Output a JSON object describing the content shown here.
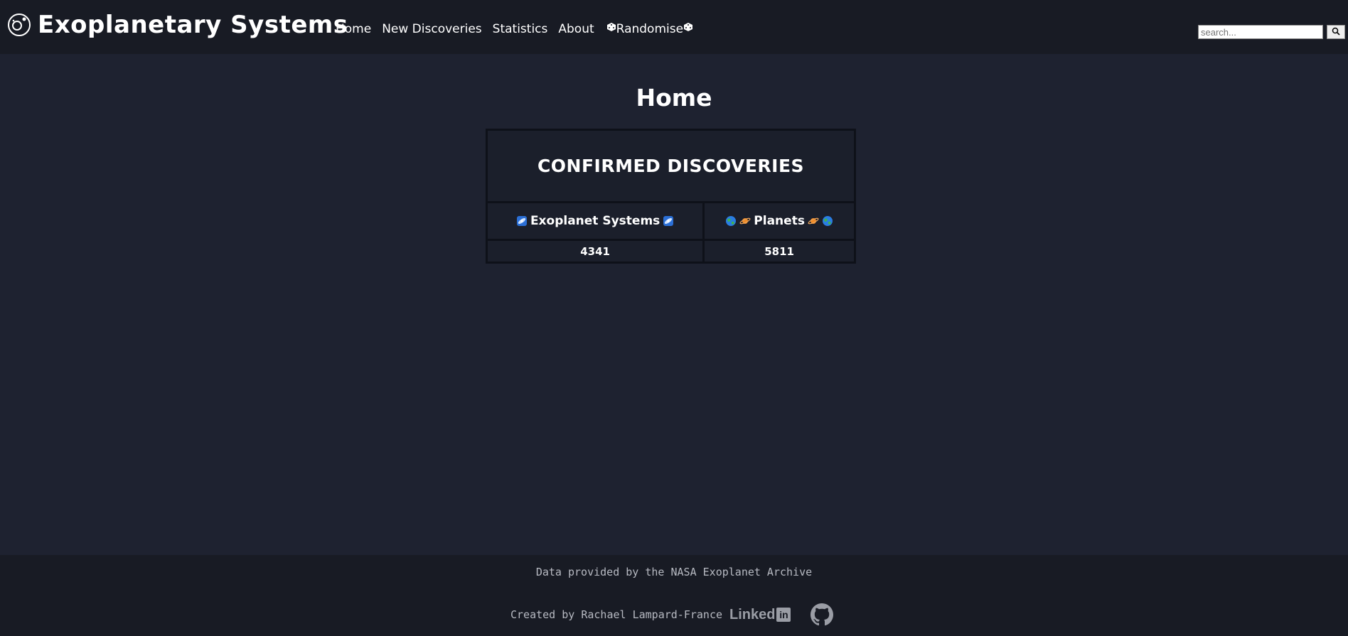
{
  "header": {
    "brand_title": "Exoplanetary Systems",
    "brand_icon": "planet-orbit-icon",
    "nav": {
      "home": "Home",
      "new_discoveries": "New Discoveries",
      "statistics": "Statistics",
      "about": "About",
      "randomise": "Randomise",
      "randomise_icon": "dice-icon"
    },
    "search": {
      "placeholder": "search...",
      "value": "",
      "button_icon": "search-icon"
    }
  },
  "main": {
    "page_title": "Home",
    "table": {
      "title": "CONFIRMED DISCOVERIES",
      "columns": [
        {
          "label": "Exoplanet Systems",
          "icon": "galaxy-icon",
          "value": "4341"
        },
        {
          "label": "Planets",
          "icon": "planet-icon",
          "value": "5811"
        }
      ]
    }
  },
  "footer": {
    "data_credit": "Data provided by the NASA Exoplanet Archive",
    "created_by": "Created by Rachael Lampard-France",
    "linkedin_text": "Linked",
    "linkedin_box": "in",
    "github_icon": "github-icon"
  },
  "colors": {
    "background": "#1e2230",
    "topbar": "#181b24",
    "table_border": "#0e1119",
    "text": "#ffffff",
    "footer_text": "#b7bac2"
  }
}
